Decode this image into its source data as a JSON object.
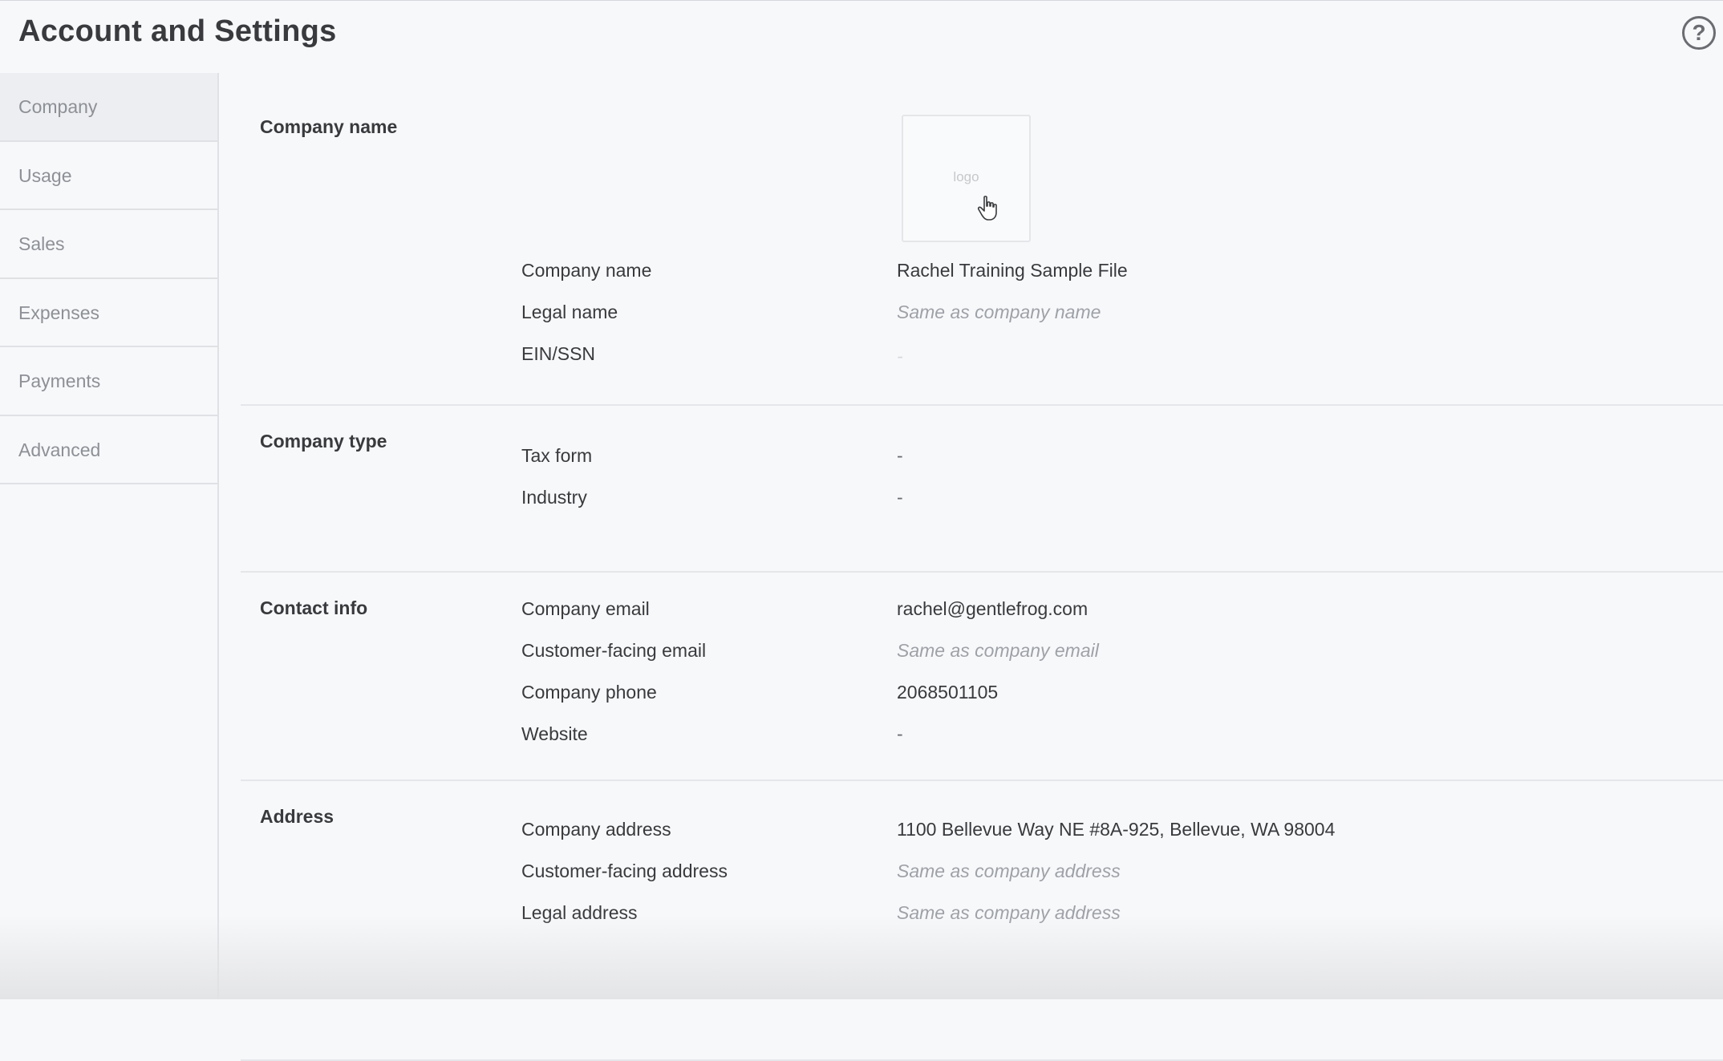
{
  "header": {
    "title": "Account and Settings",
    "help_icon": "question-circle-icon",
    "help_glyph": "?"
  },
  "sidebar": {
    "items": [
      {
        "label": "Company",
        "active": true
      },
      {
        "label": "Usage"
      },
      {
        "label": "Sales"
      },
      {
        "label": "Expenses"
      },
      {
        "label": "Payments"
      },
      {
        "label": "Advanced"
      }
    ]
  },
  "company_name_section": {
    "title": "Company name",
    "logo_text": "logo",
    "rows": [
      {
        "label": "Company name",
        "value": "Rachel Training Sample File"
      },
      {
        "label": "Legal name",
        "value": "Same as company name"
      },
      {
        "label": "EIN/SSN",
        "value": "-"
      }
    ]
  },
  "company_type_section": {
    "title": "Company type",
    "rows": [
      {
        "label": "Tax form",
        "value": "-"
      },
      {
        "label": "Industry",
        "value": "-"
      }
    ]
  },
  "contact_info_section": {
    "title": "Contact info",
    "rows": [
      {
        "label": "Company email",
        "value": "rachel@gentlefrog.com"
      },
      {
        "label": "Customer-facing email",
        "value": "Same as company email"
      },
      {
        "label": "Company phone",
        "value": "2068501105"
      },
      {
        "label": "Website",
        "value": "-"
      }
    ]
  },
  "address_section": {
    "title": "Address",
    "rows": [
      {
        "label": "Company address",
        "value": "1100 Bellevue Way NE #8A-925, Bellevue, WA 98004"
      },
      {
        "label": "Customer-facing address",
        "value": "Same as company address"
      },
      {
        "label": "Legal address",
        "value": "Same as company address"
      }
    ]
  },
  "colors": {
    "background": "#f7f8fa",
    "text": "#393a3d",
    "muted": "#8d9096",
    "placeholder": "#9ea1a7",
    "divider": "#dfe1e4"
  }
}
